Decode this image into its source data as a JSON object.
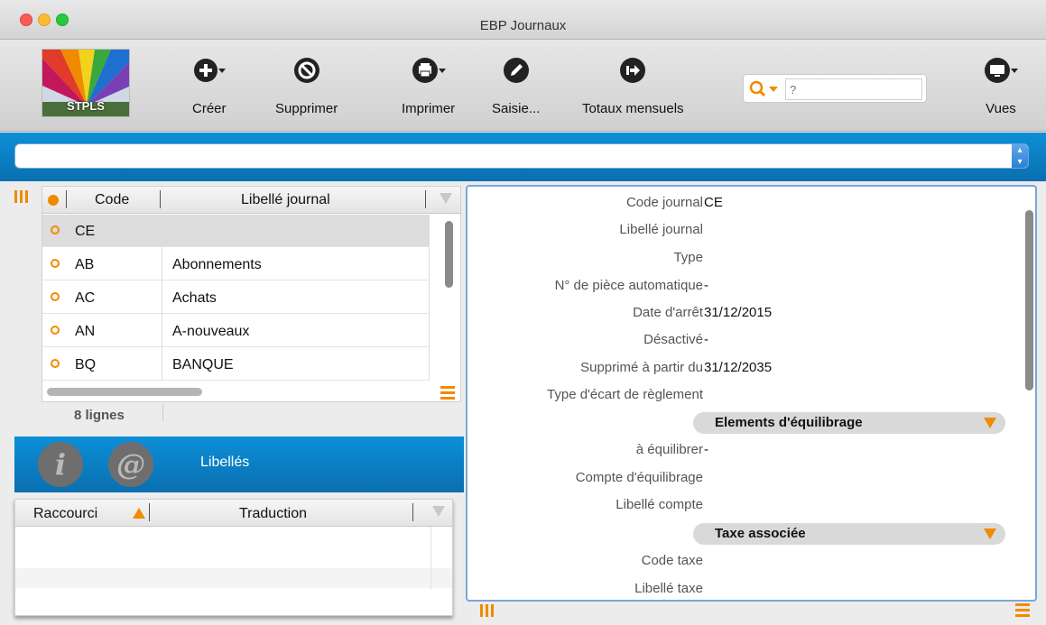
{
  "window": {
    "title": "EBP Journaux"
  },
  "logo": {
    "text": "STPLS"
  },
  "toolbar": {
    "create": "Créer",
    "delete": "Supprimer",
    "print": "Imprimer",
    "entry": "Saisie...",
    "monthly_totals": "Totaux mensuels",
    "views": "Vues"
  },
  "search": {
    "placeholder": "?"
  },
  "journal_table": {
    "col_code": "Code",
    "col_label": "Libellé journal",
    "rows": [
      {
        "code": "CE",
        "label": ""
      },
      {
        "code": "AB",
        "label": "Abonnements"
      },
      {
        "code": "AC",
        "label": "Achats"
      },
      {
        "code": "AN",
        "label": "A-nouveaux"
      },
      {
        "code": "BQ",
        "label": "BANQUE"
      }
    ],
    "count": "8 lignes"
  },
  "labels_panel": {
    "info_icon": "i",
    "at_icon": "@",
    "title": "Libellés",
    "col_shortcut": "Raccourci",
    "col_translation": "Traduction"
  },
  "detail": {
    "fields": [
      {
        "label": "Code journal",
        "value": "CE"
      },
      {
        "label": "Libellé journal",
        "value": ""
      },
      {
        "label": "Type",
        "value": ""
      },
      {
        "label": "N° de pièce automatique",
        "value": "-"
      },
      {
        "label": "Date d'arrêt",
        "value": "31/12/2015"
      },
      {
        "label": "Désactivé",
        "value": "-"
      },
      {
        "label": "Supprimé à partir du",
        "value": "31/12/2035"
      },
      {
        "label": "Type d'écart de règlement",
        "value": ""
      }
    ],
    "section_balance": "Elements d'équilibrage",
    "balance_fields": [
      {
        "label": "à équilibrer",
        "value": "-"
      },
      {
        "label": "Compte d'équilibrage",
        "value": ""
      },
      {
        "label": "Libellé compte",
        "value": ""
      }
    ],
    "section_tax": "Taxe associée",
    "tax_fields": [
      {
        "label": "Code taxe",
        "value": ""
      },
      {
        "label": "Libellé taxe",
        "value": ""
      }
    ]
  },
  "colors": {
    "accent": "#f08a00",
    "blue": "#0a80c8"
  }
}
